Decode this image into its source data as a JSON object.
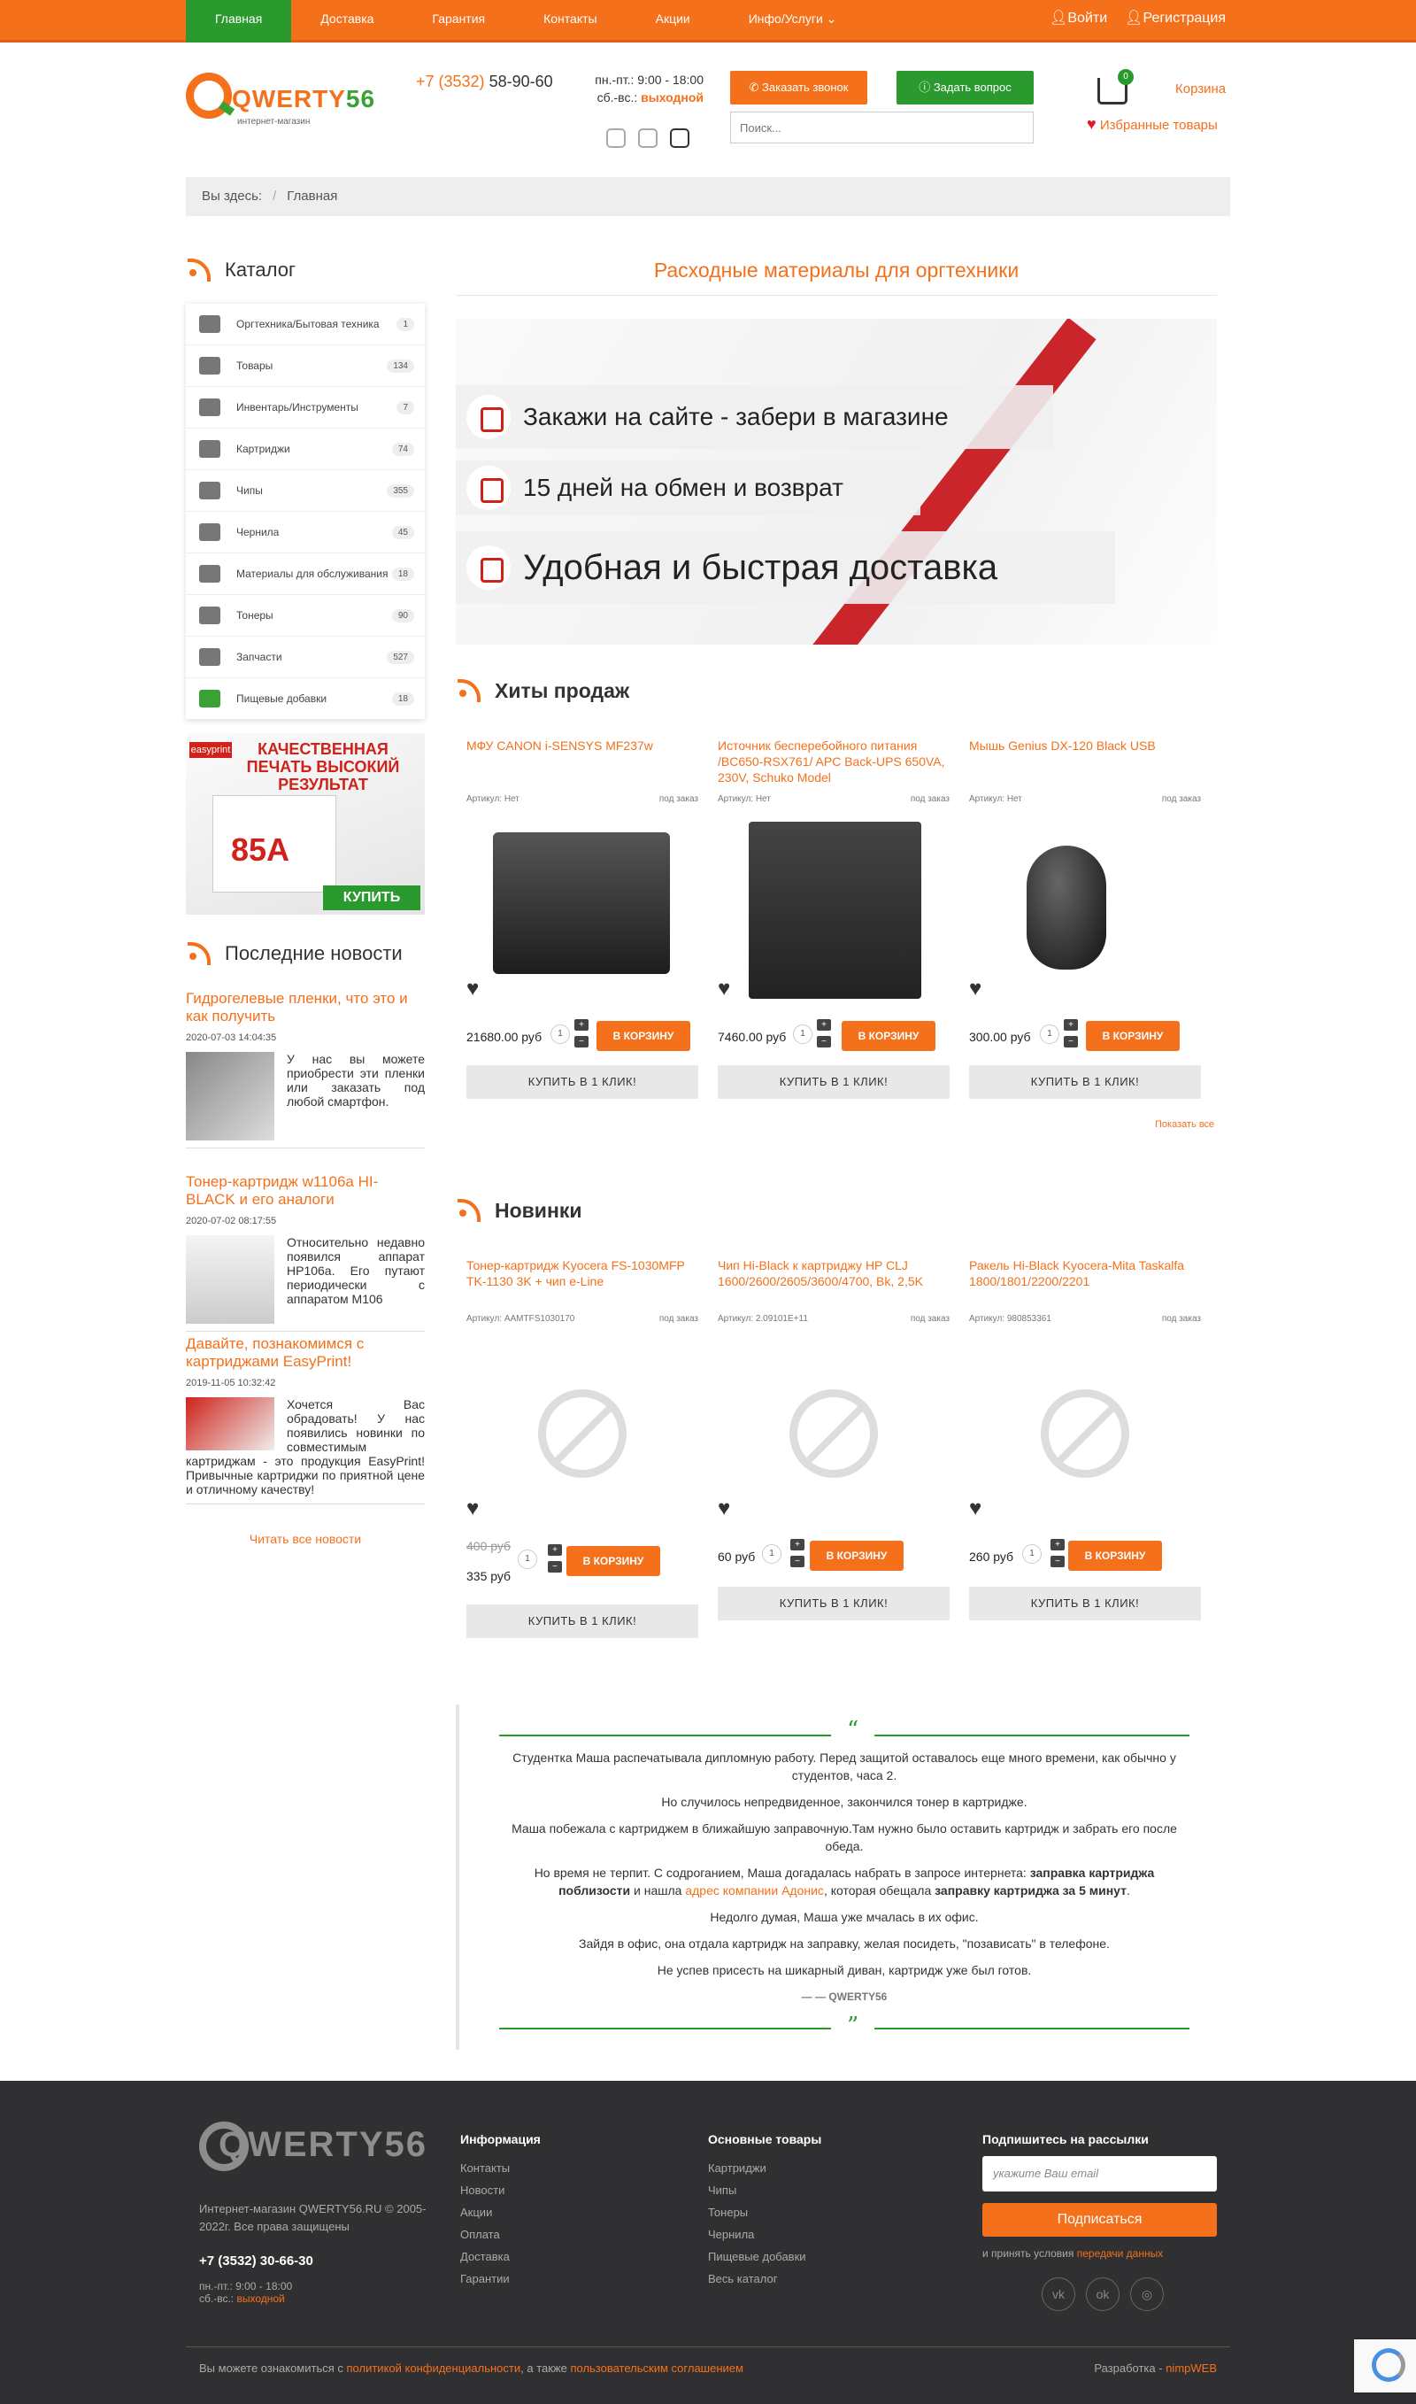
{
  "nav": {
    "items": [
      "Главная",
      "Доставка",
      "Гарантия",
      "Контакты",
      "Акции",
      "Инфо/Услуги"
    ],
    "login": "Войти",
    "register": "Регистрация"
  },
  "header": {
    "logo_main": "QWERTY",
    "logo_num": "56",
    "logo_sub": "интернет-магазин",
    "phone_code": "+7 (3532)",
    "phone_num": "58-90-60",
    "hours_weekday": "пн.-пт.: 9:00 - 18:00",
    "hours_weekend_label": "сб.-вс.:",
    "hours_weekend": "выходной",
    "call_button": "Заказать звонок",
    "ask_button": "Задать вопрос",
    "search_placeholder": "Поиск...",
    "cart_count": "0",
    "cart_label": "Корзина",
    "favorites_label": "Избранные товары"
  },
  "breadcrumb": {
    "prefix": "Вы здесь:",
    "current": "Главная"
  },
  "catalog": {
    "title": "Каталог",
    "items": [
      {
        "label": "Оргтехника/Бытовая техника",
        "count": "1"
      },
      {
        "label": "Товары",
        "count": "134"
      },
      {
        "label": "Инвентарь/Инструменты",
        "count": "7"
      },
      {
        "label": "Картриджи",
        "count": "74"
      },
      {
        "label": "Чипы",
        "count": "355"
      },
      {
        "label": "Чернила",
        "count": "45"
      },
      {
        "label": "Материалы для обслуживания",
        "count": "18"
      },
      {
        "label": "Тонеры",
        "count": "90"
      },
      {
        "label": "Запчасти",
        "count": "527"
      },
      {
        "label": "Пищевые добавки",
        "count": "18"
      }
    ]
  },
  "promo": {
    "brand": "easyprint",
    "headline": "КАЧЕСТВЕННАЯ ПЕЧАТЬ ВЫСОКИЙ РЕЗУЛЬТАТ",
    "model": "85A",
    "button": "КУПИТЬ"
  },
  "news": {
    "title": "Последние новости",
    "items": [
      {
        "title": "Гидрогелевые пленки, что это и как получить",
        "date": "2020-07-03 14:04:35",
        "text": "У нас вы можете приобрести эти пленки или заказать под любой смартфон."
      },
      {
        "title": "Тонер-картридж w1106a HI-BLACK и его аналоги",
        "date": "2020-07-02 08:17:55",
        "text": "Относительно недавно появился аппарат HP106a. Его путают периодически с аппаратом M106"
      },
      {
        "title": "Давайте, познакомимся с картриджами EasyPrint!",
        "date": "2019-11-05 10:32:42",
        "text": "Хочется Вас обрадовать! У нас появились новинки по совместимым картриджам - это продукция EasyPrint! Привычные картриджи по приятной цене и отличному качеству!"
      }
    ],
    "all_link": "Читать все новости"
  },
  "main": {
    "title": "Расходные материалы для оргтехники",
    "banner": [
      "Закажи на сайте - забери в магазине",
      "15 дней на обмен и возврат",
      "Удобная и быстрая доставка"
    ]
  },
  "hits": {
    "title": "Хиты продаж",
    "products": [
      {
        "name": "МФУ CANON i-SENSYS MF237w",
        "sku": "Артикул: Нет",
        "status": "под заказ",
        "price": "21680.00 руб",
        "qty": "1"
      },
      {
        "name": "Источник бесперебойного питания /BC650-RSX761/ APC Back-UPS 650VA, 230V, Schuko Model",
        "sku": "Артикул: Нет",
        "status": "под заказ",
        "price": "7460.00 руб",
        "qty": "1"
      },
      {
        "name": "Мышь Genius DX-120 Black USB",
        "sku": "Артикул: Нет",
        "status": "под заказ",
        "price": "300.00 руб",
        "qty": "1"
      }
    ],
    "to_cart": "В КОРЗИНУ",
    "one_click": "КУПИТЬ В 1 КЛИК!",
    "show_all": "Показать все"
  },
  "new": {
    "title": "Новинки",
    "products": [
      {
        "name": "Тонер-картридж Kyocera FS-1030MFP TK-1130 3K + чип e-Line",
        "sku": "Артикул: AAMTFS1030170",
        "status": "под заказ",
        "old_price": "400 руб",
        "price": "335 руб",
        "qty": "1"
      },
      {
        "name": "Чип Hi-Black к картриджу HP CLJ 1600/2600/2605/3600/4700, Bk, 2,5K",
        "sku": "Артикул: 2.09101E+11",
        "status": "под заказ",
        "price": "60 руб",
        "qty": "1"
      },
      {
        "name": "Ракель Hi-Black Kyocera-Mita Taskalfa 1800/1801/2200/2201",
        "sku": "Артикул: 980853361",
        "status": "под заказ",
        "price": "260 руб",
        "qty": "1"
      }
    ]
  },
  "testimonial": {
    "open_quote": "“",
    "close_quote": "”",
    "p1": "Студентка Маша распечатывала дипломную работу. Перед защитой оставалось еще много времени, как обычно у студентов, часа 2.",
    "p2": "Но случилось непредвиденное, закончился тонер в картридже.",
    "p3": "Маша побежала с картриджем в ближайшую заправочную.Там нужно было оставить картридж и забрать его после обеда.",
    "p4a": "Но время не терпит. С содроганием, Маша догадалась набрать в запросе интернета:",
    "p4b": "заправка картриджа поблизости",
    "p4c": "и нашла",
    "p4d": "адрес компании Адонис",
    "p4e": ", которая обещала",
    "p4f": "заправку картриджа за 5 минут",
    "p5": "Недолго думая, Маша уже мчалась в их офис.",
    "p6": "Зайдя в офис, она отдала картридж на заправку, желая посидеть, \"позависать\" в телефоне.",
    "p7": "Не успев присесть на шикарный диван, картридж уже был готов.",
    "author": "— — QWERTY56"
  },
  "footer": {
    "logo": "QWERTY56",
    "copyright": "Интернет-магазин QWERTY56.RU © 2005-2022г. Все права защищены",
    "phone": "+7 (3532) 30-66-30",
    "hours": "пн.-пт.: 9:00 - 18:00",
    "weekend_label": "сб.-вс.:",
    "weekend": "выходной",
    "info_title": "Информация",
    "info_links": [
      "Контакты",
      "Новости",
      "Акции",
      "Оплата",
      "Доставка",
      "Гарантии"
    ],
    "goods_title": "Основные товары",
    "goods_links": [
      "Картриджи",
      "Чипы",
      "Тонеры",
      "Чернила",
      "Пищевые добавки",
      "Весь каталог"
    ],
    "subscribe_title": "Подпишитесь на рассылки",
    "email_placeholder": "укажите Ваш email",
    "subscribe_button": "Подписаться",
    "agree_text": "и принять условия",
    "agree_link": "передачи данных",
    "policy_a": "Вы можете ознакомиться с",
    "policy_link1": "политикой конфиденциальности",
    "policy_b": ", а также",
    "policy_link2": "пользовательским соглашением",
    "dev_label": "Разработка -",
    "dev_link": "nimpWEB"
  },
  "colors": {
    "accent": "#f4701b",
    "green": "#2a9a2f",
    "footer_bg": "#303033"
  }
}
